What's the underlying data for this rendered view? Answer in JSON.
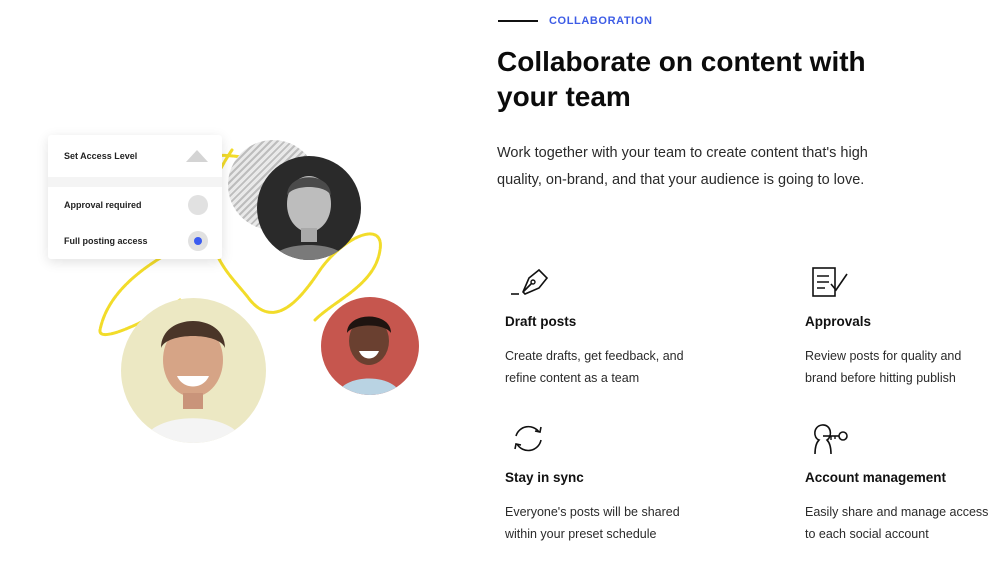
{
  "access_card": {
    "title": "Set Access Level",
    "options": [
      {
        "label": "Approval required",
        "selected": false
      },
      {
        "label": "Full posting access",
        "selected": true
      }
    ]
  },
  "section": {
    "eyebrow": "COLLABORATION",
    "title": "Collaborate on content with your team",
    "description": "Work together with your team to create content that's high quality, on-brand, and that your audience is going to love."
  },
  "features": [
    {
      "icon": "pen-nib-icon",
      "title": "Draft posts",
      "description": "Create drafts, get feedback, and refine content as a team"
    },
    {
      "icon": "checklist-icon",
      "title": "Approvals",
      "description": "Review posts for quality and brand before hitting publish"
    },
    {
      "icon": "sync-icon",
      "title": "Stay in sync",
      "description": "Everyone's posts will be shared within your preset schedule"
    },
    {
      "icon": "key-user-icon",
      "title": "Account management",
      "description": "Easily share and manage access to each social account"
    }
  ],
  "colors": {
    "accent": "#3d5ce6",
    "scribble": "#f2dc2a",
    "radio_on": "#3b5cf0"
  }
}
